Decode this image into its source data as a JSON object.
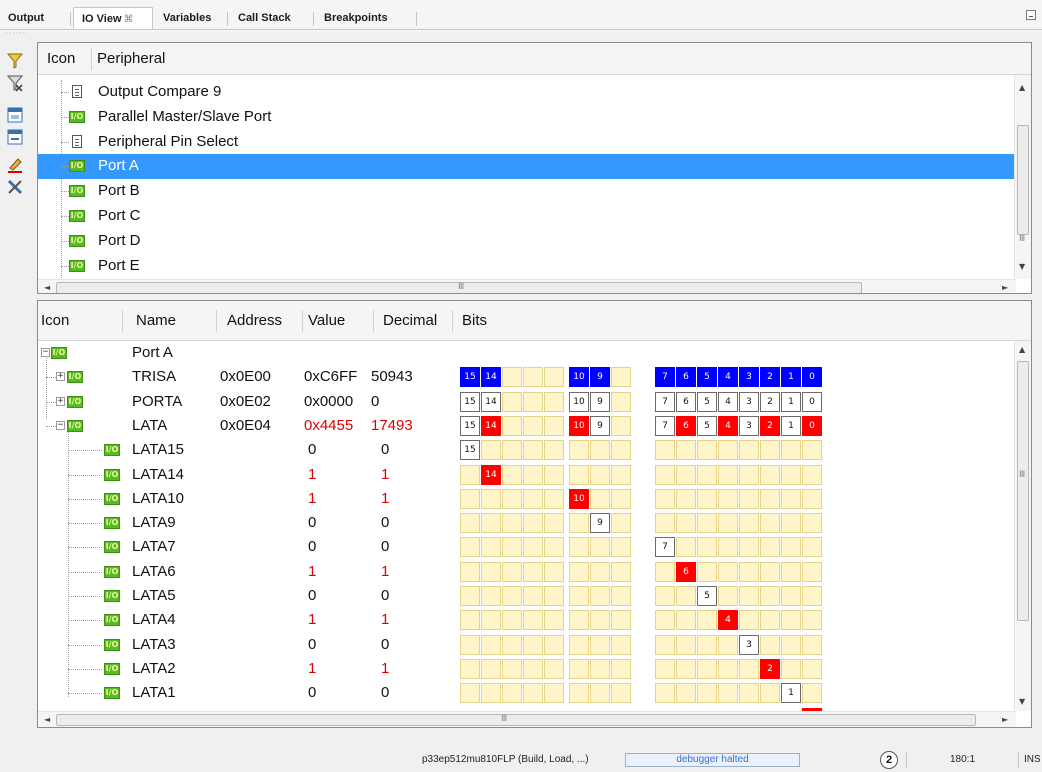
{
  "tabs": [
    {
      "label": "Output",
      "active": false
    },
    {
      "label": "IO View",
      "active": true,
      "close_glyph": "⌘"
    },
    {
      "label": "Variables",
      "active": false
    },
    {
      "label": "Call Stack",
      "active": false
    },
    {
      "label": "Breakpoints",
      "active": false
    }
  ],
  "toolbar_icons": [
    "filter-icon",
    "filter-off-icon",
    "window-icon",
    "window-alt-icon",
    "edit-clear-icon",
    "tools-icon"
  ],
  "peripheral_panel": {
    "columns": [
      "Icon",
      "Peripheral"
    ],
    "rows": [
      {
        "icon": "document-icon",
        "label": "Output Compare 9",
        "selected": false
      },
      {
        "icon": "io-icon",
        "label": "Parallel Master/Slave Port",
        "selected": false
      },
      {
        "icon": "document-icon",
        "label": "Peripheral Pin Select",
        "selected": false
      },
      {
        "icon": "io-icon",
        "label": "Port A",
        "selected": true
      },
      {
        "icon": "io-icon",
        "label": "Port B",
        "selected": false
      },
      {
        "icon": "io-icon",
        "label": "Port C",
        "selected": false
      },
      {
        "icon": "io-icon",
        "label": "Port D",
        "selected": false
      },
      {
        "icon": "io-icon",
        "label": "Port E",
        "selected": false
      }
    ],
    "scroll_grip": "Ⅲ"
  },
  "register_panel": {
    "columns": [
      "Icon",
      "Name",
      "Address",
      "Value",
      "Decimal",
      "Bits"
    ],
    "group": {
      "name": "Port A",
      "expander": "−"
    },
    "rows": [
      {
        "expander": "+",
        "name": "TRISA",
        "address": "0x0E00",
        "value": "0xC6FF",
        "decimal": "50943",
        "changed": false,
        "bits": {
          "15": "B",
          "14": "B",
          "10": "B",
          "9": "B",
          "7": "B",
          "6": "B",
          "5": "B",
          "4": "B",
          "3": "B",
          "2": "B",
          "1": "B",
          "0": "B"
        }
      },
      {
        "expander": "+",
        "name": "PORTA",
        "address": "0x0E02",
        "value": "0x0000",
        "decimal": "0",
        "changed": false,
        "bits": {
          "15": "W",
          "14": "W",
          "10": "W",
          "9": "W",
          "7": "W",
          "6": "W",
          "5": "W",
          "4": "W",
          "3": "W",
          "2": "W",
          "1": "W",
          "0": "W"
        }
      },
      {
        "expander": "−",
        "name": "LATA",
        "address": "0x0E04",
        "value": "0x4455",
        "decimal": "17493",
        "changed": true,
        "bits": {
          "15": "W",
          "14": "R",
          "10": "R",
          "9": "W",
          "7": "W",
          "6": "R",
          "5": "W",
          "4": "R",
          "3": "W",
          "2": "R",
          "1": "W",
          "0": "R"
        }
      },
      {
        "name": "LATA15",
        "value": "0",
        "decimal": "0",
        "changed": false,
        "bit": 15
      },
      {
        "name": "LATA14",
        "value": "1",
        "decimal": "1",
        "changed": true,
        "bit": 14
      },
      {
        "name": "LATA10",
        "value": "1",
        "decimal": "1",
        "changed": true,
        "bit": 10
      },
      {
        "name": "LATA9",
        "value": "0",
        "decimal": "0",
        "changed": false,
        "bit": 9
      },
      {
        "name": "LATA7",
        "value": "0",
        "decimal": "0",
        "changed": false,
        "bit": 7
      },
      {
        "name": "LATA6",
        "value": "1",
        "decimal": "1",
        "changed": true,
        "bit": 6
      },
      {
        "name": "LATA5",
        "value": "0",
        "decimal": "0",
        "changed": false,
        "bit": 5
      },
      {
        "name": "LATA4",
        "value": "1",
        "decimal": "1",
        "changed": true,
        "bit": 4
      },
      {
        "name": "LATA3",
        "value": "0",
        "decimal": "0",
        "changed": false,
        "bit": 3
      },
      {
        "name": "LATA2",
        "value": "1",
        "decimal": "1",
        "changed": true,
        "bit": 2
      },
      {
        "name": "LATA1",
        "value": "0",
        "decimal": "0",
        "changed": false,
        "bit": 1
      }
    ],
    "scroll_grip": "Ⅲ"
  },
  "colors": {
    "selection": "#3399ff",
    "bit_set_tris": "#0000ff",
    "bit_changed": "#ff0000",
    "bit_cell": "#fff5c9",
    "changed_text": "#e00000"
  },
  "status": {
    "project": "p33ep512mu810FLP (Build, Load, ...)",
    "debugger": "debugger halted",
    "notifications": "2",
    "position": "180:1",
    "mode": "INS"
  }
}
